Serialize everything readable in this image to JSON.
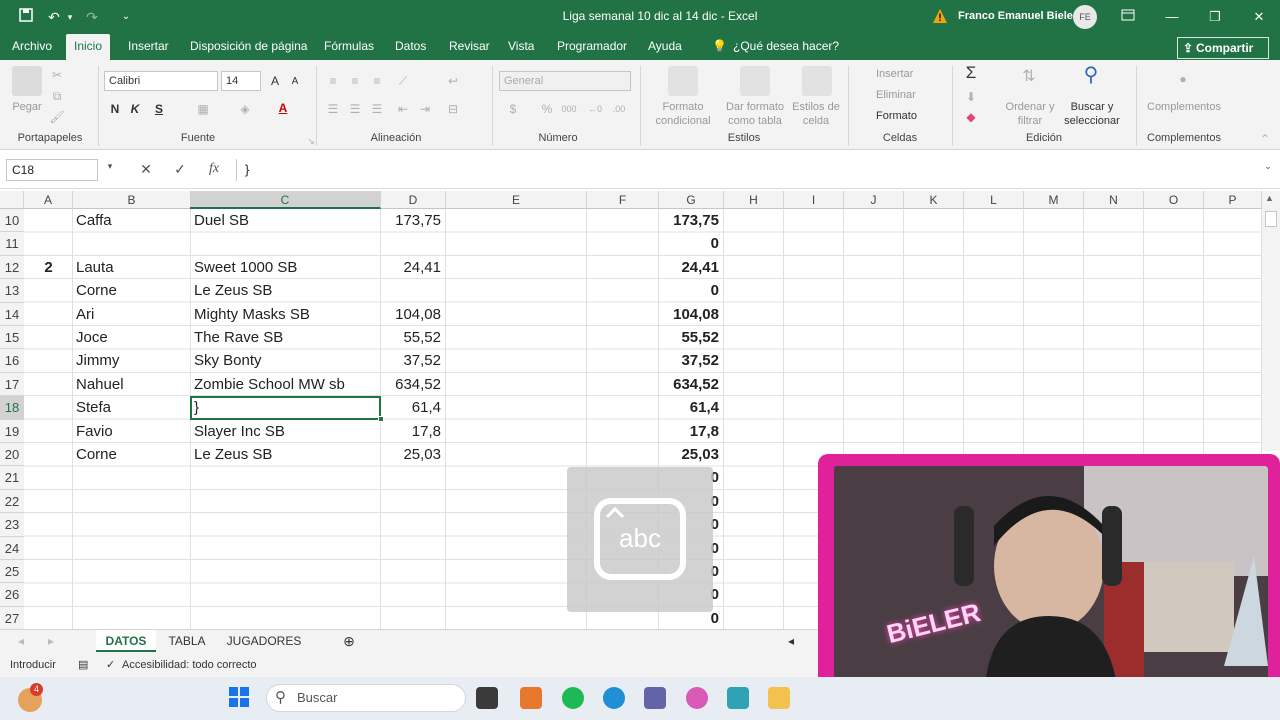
{
  "window": {
    "title": "Liga semanal 10 dic al 14 dic  -  Excel",
    "user": "Franco Emanuel Bieler",
    "user_initials": "FE"
  },
  "ribbon_tabs": [
    "Archivo",
    "Inicio",
    "Insertar",
    "Disposición de página",
    "Fórmulas",
    "Datos",
    "Revisar",
    "Vista",
    "Programador",
    "Ayuda",
    "¿Qué desea hacer?"
  ],
  "active_tab": "Inicio",
  "share_label": "Compartir",
  "ribbon": {
    "paste": "Pegar",
    "font_name": "Calibri",
    "font_size": "14",
    "bold": "N",
    "italic": "K",
    "underline": "S",
    "number_format": "General",
    "conditional_format": "Formato condicional",
    "format_table": "Dar formato como tabla",
    "cell_styles": "Estilos de celda",
    "insert": "Insertar",
    "delete": "Eliminar",
    "format": "Formato",
    "sort_filter": "Ordenar y filtrar",
    "find_select": "Buscar y seleccionar",
    "addins": "Complementos",
    "groups": {
      "clipboard": "Portapapeles",
      "font": "Fuente",
      "alignment": "Alineación",
      "number": "Número",
      "styles": "Estilos",
      "cells": "Celdas",
      "editing": "Edición",
      "addins": "Complementos"
    }
  },
  "formula_bar": {
    "name_box": "C18",
    "fx": "fx",
    "content": "}"
  },
  "columns": [
    "A",
    "B",
    "C",
    "D",
    "E",
    "F",
    "G",
    "H",
    "I",
    "J",
    "K",
    "L",
    "M",
    "N",
    "O",
    "P"
  ],
  "rows": [
    {
      "n": "10",
      "a": "",
      "b": "Caffa",
      "c": "Duel SB",
      "d": "173,75",
      "g": "173,75"
    },
    {
      "n": "11",
      "a": "",
      "b": "",
      "c": "",
      "d": "",
      "g": "0"
    },
    {
      "n": "12",
      "a": "2",
      "b": "Lauta",
      "c": "Sweet 1000 SB",
      "d": "24,41",
      "g": "24,41"
    },
    {
      "n": "13",
      "a": "",
      "b": "Corne",
      "c": "Le Zeus SB",
      "d": "",
      "g": "0"
    },
    {
      "n": "14",
      "a": "",
      "b": "Ari",
      "c": "Mighty Masks SB",
      "d": "104,08",
      "g": "104,08"
    },
    {
      "n": "15",
      "a": "",
      "b": "Joce",
      "c": "The Rave SB",
      "d": "55,52",
      "g": "55,52"
    },
    {
      "n": "16",
      "a": "",
      "b": "Jimmy",
      "c": "Sky Bonty",
      "d": "37,52",
      "g": "37,52"
    },
    {
      "n": "17",
      "a": "",
      "b": "Nahuel",
      "c": "Zombie School MW sb",
      "d": "634,52",
      "g": "634,52"
    },
    {
      "n": "18",
      "a": "",
      "b": "Stefa",
      "c": "}",
      "d": "61,4",
      "g": "61,4"
    },
    {
      "n": "19",
      "a": "",
      "b": "Favio",
      "c": "Slayer Inc SB",
      "d": "17,8",
      "g": "17,8"
    },
    {
      "n": "20",
      "a": "",
      "b": "Corne",
      "c": "Le Zeus SB",
      "d": "25,03",
      "g": "25,03"
    },
    {
      "n": "21",
      "a": "",
      "b": "",
      "c": "",
      "d": "",
      "g": "0"
    },
    {
      "n": "22",
      "a": "",
      "b": "",
      "c": "",
      "d": "",
      "g": "0"
    },
    {
      "n": "23",
      "a": "",
      "b": "",
      "c": "",
      "d": "",
      "g": "0"
    },
    {
      "n": "24",
      "a": "",
      "b": "",
      "c": "",
      "d": "",
      "g": "0"
    },
    {
      "n": "25",
      "a": "",
      "b": "",
      "c": "",
      "d": "",
      "g": "0"
    },
    {
      "n": "26",
      "a": "",
      "b": "",
      "c": "",
      "d": "",
      "g": "0"
    },
    {
      "n": "27",
      "a": "",
      "b": "",
      "c": "",
      "d": "",
      "g": "0"
    }
  ],
  "sheets": [
    "DATOS",
    "TABLA",
    "JUGADORES"
  ],
  "active_sheet": "DATOS",
  "status": {
    "mode": "Introducir",
    "accessibility": "Accesibilidad: todo correcto"
  },
  "taskbar": {
    "search": "Buscar",
    "notification_count": "4"
  },
  "overlay": {
    "keyboard_text": "abc",
    "webcam_sign": "BiELER"
  },
  "colors": {
    "excel_green": "#217346",
    "webcam_frame": "#e0219c"
  }
}
